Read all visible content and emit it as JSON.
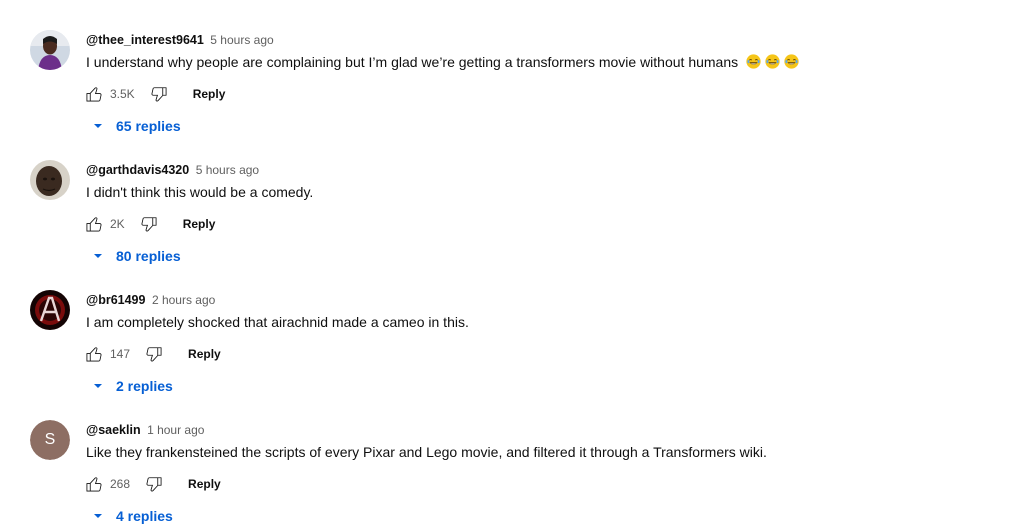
{
  "comments": [
    {
      "author": "@thee_interest9641",
      "time": "5 hours ago",
      "text": "I understand why people are complaining but I’m glad we’re getting a transformers movie without humans",
      "emoji": [
        "😂",
        "😂",
        "😂"
      ],
      "likes": "3.5K",
      "reply_label": "Reply",
      "replies_label": "65 replies"
    },
    {
      "author": "@garthdavis4320",
      "time": "5 hours ago",
      "text": "I didn't think this would be a comedy.",
      "likes": "2K",
      "reply_label": "Reply",
      "replies_label": "80 replies"
    },
    {
      "author": "@br61499",
      "time": "2 hours ago",
      "text": "I am completely shocked that airachnid made a cameo in this.",
      "likes": "147",
      "reply_label": "Reply",
      "replies_label": "2 replies"
    },
    {
      "author": "@saeklin",
      "time": "1 hour ago",
      "text": "Like they frankensteined the scripts of every Pixar and Lego movie, and filtered it through a Transformers wiki.",
      "likes": "268",
      "reply_label": "Reply",
      "replies_label": "4 replies",
      "avatar_letter": "S"
    }
  ],
  "colors": {
    "link_blue": "#065fd4",
    "meta_gray": "#606060",
    "avatar_s_bg": "#8d6e63"
  }
}
